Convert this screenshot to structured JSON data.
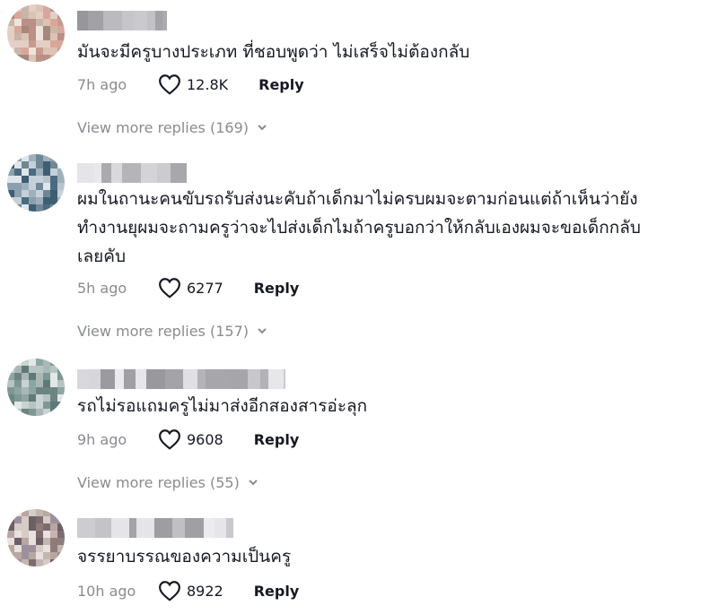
{
  "colors": {
    "text": "#161823",
    "muted": "#8a8b91",
    "background": "#ffffff"
  },
  "comments": [
    {
      "text": "มันจะมีครูบางประเภท ที่ชอบพูดว่า ไม่เสร็จไม่ต้องกลับ",
      "time": "7h ago",
      "likes": "12.8K",
      "reply_label": "Reply",
      "view_more": "View more replies (169)"
    },
    {
      "text": "ผมในถานะคนขับรถรับส่งนะคับถ้าเด็กมาไม่ครบผมจะตามก่อนแต่ถ้าเห็นว่ายัง\nทำงานยุผมจะถามครูว่าจะไปส่งเด็กไมถ้าครูบอกว่าให้กลับเองผมจะขอเด็กกลับ\nเลยคับ",
      "time": "5h ago",
      "likes": "6277",
      "reply_label": "Reply",
      "view_more": "View more replies (157)"
    },
    {
      "text": "รถไม่รอแถมครูไม่มาส่งอีกสองสารอ่ะลุก",
      "time": "9h ago",
      "likes": "9608",
      "reply_label": "Reply",
      "view_more": "View more replies (55)"
    },
    {
      "text": "จรรยาบรรณของความเป็นครู",
      "time": "10h ago",
      "likes": "8922",
      "reply_label": "Reply"
    }
  ],
  "icons": {
    "like": "heart-outline-icon",
    "expand": "chevron-down-icon"
  }
}
